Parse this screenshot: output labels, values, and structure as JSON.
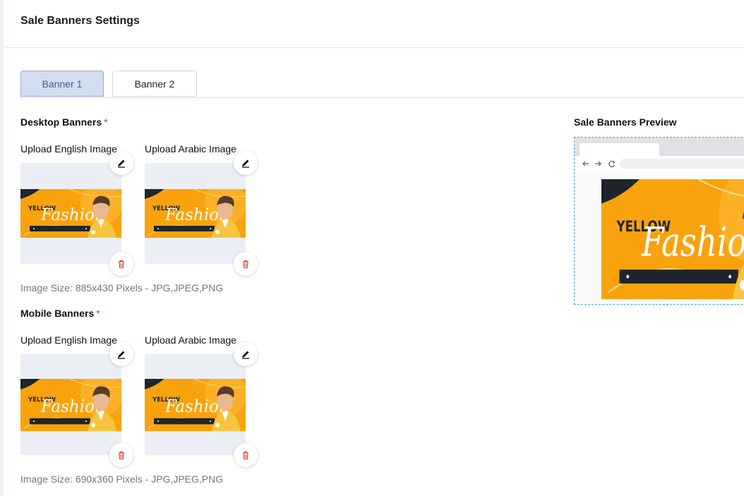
{
  "page": {
    "title": "Sale Banners Settings"
  },
  "tabs": [
    {
      "label": "Banner 1",
      "active": true
    },
    {
      "label": "Banner 2",
      "active": false
    }
  ],
  "desktop": {
    "title": "Desktop Banners",
    "required_mark": "*",
    "english_label": "Upload English Image",
    "arabic_label": "Upload Arabic Image",
    "hint": "Image Size: 885x430 Pixels - JPG,JPEG,PNG"
  },
  "mobile": {
    "title": "Mobile Banners",
    "required_mark": "*",
    "english_label": "Upload English Image",
    "arabic_label": "Upload Arabic Image",
    "hint": "Image Size: 690x360 Pixels - JPG,JPEG,PNG"
  },
  "preview": {
    "title": "Sale Banners Preview"
  },
  "banner_art": {
    "brand": "YELLOW",
    "word": "Fashion"
  },
  "icons": {
    "edit": "pencil-icon",
    "delete": "trash-icon",
    "back": "arrow-left-icon",
    "forward": "arrow-right-icon",
    "reload": "reload-icon"
  },
  "colors": {
    "accent": "#d3ddf0",
    "banner_orange": "#f8a20e",
    "delete_red": "#e04b3f",
    "preview_border": "#4a9fd6"
  }
}
